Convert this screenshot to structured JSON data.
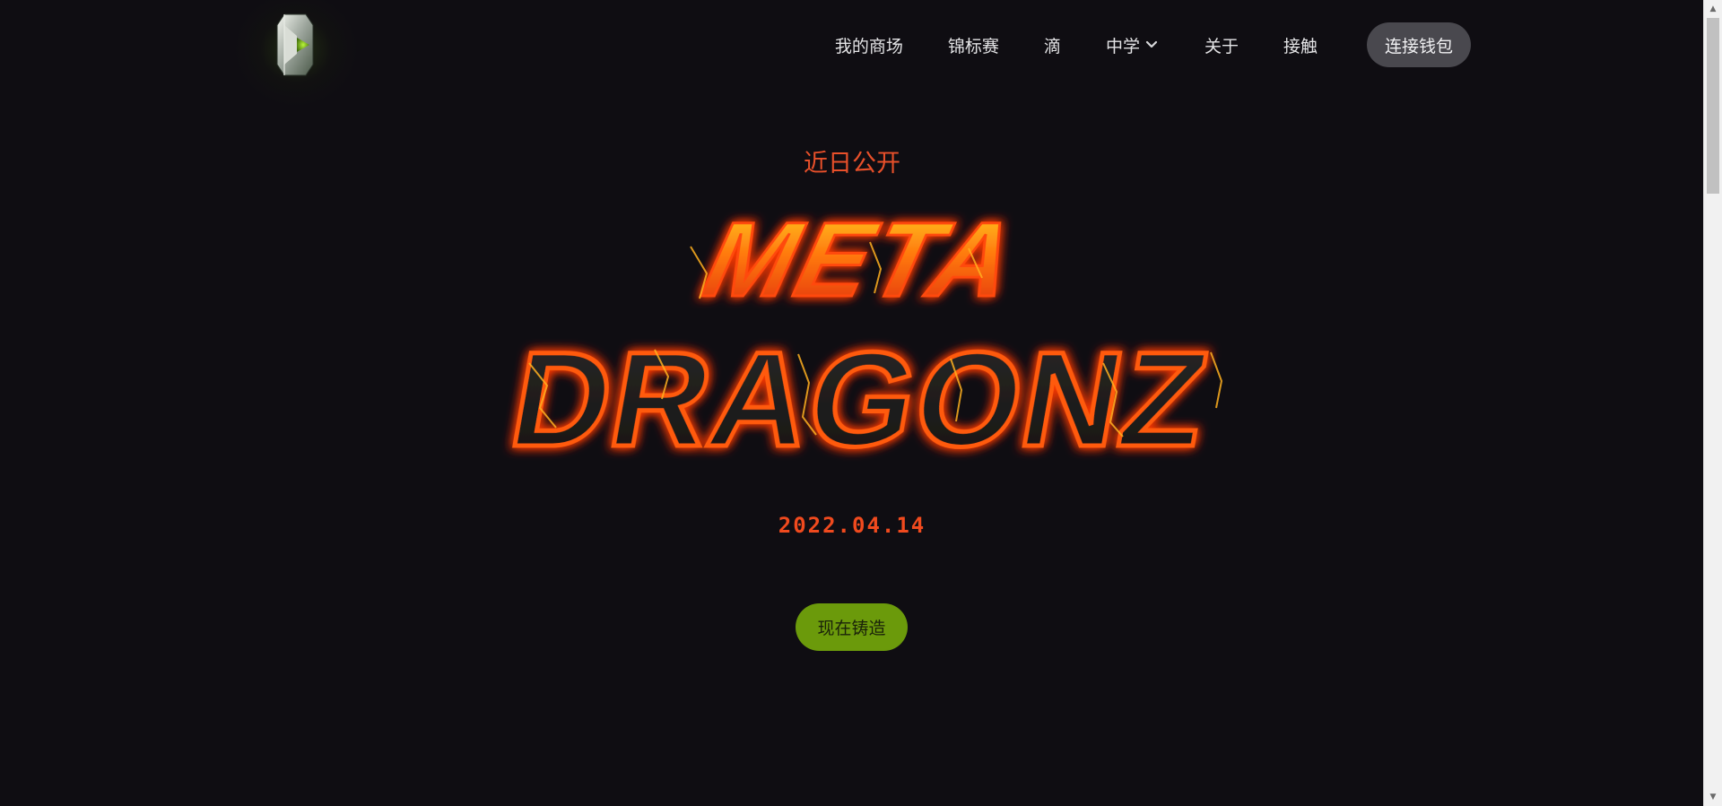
{
  "nav": {
    "items": [
      {
        "label": "我的商场"
      },
      {
        "label": "锦标赛"
      },
      {
        "label": "滴"
      },
      {
        "label": "中学",
        "has_dropdown": true
      },
      {
        "label": "关于"
      },
      {
        "label": "接触"
      }
    ],
    "wallet_button": "连接钱包"
  },
  "hero": {
    "kicker": "近日公开",
    "title_line1": "META",
    "title_line2": "DRAGONZ",
    "date": "2022.04.14",
    "cta": "现在铸造"
  },
  "colors": {
    "background": "#0f0d12",
    "accent_orange": "#e8502a",
    "cta_green": "#6b9a0b",
    "wallet_button_bg": "#49484e"
  },
  "icons": {
    "logo": "gem-logo-icon",
    "dropdown": "chevron-down-icon"
  }
}
